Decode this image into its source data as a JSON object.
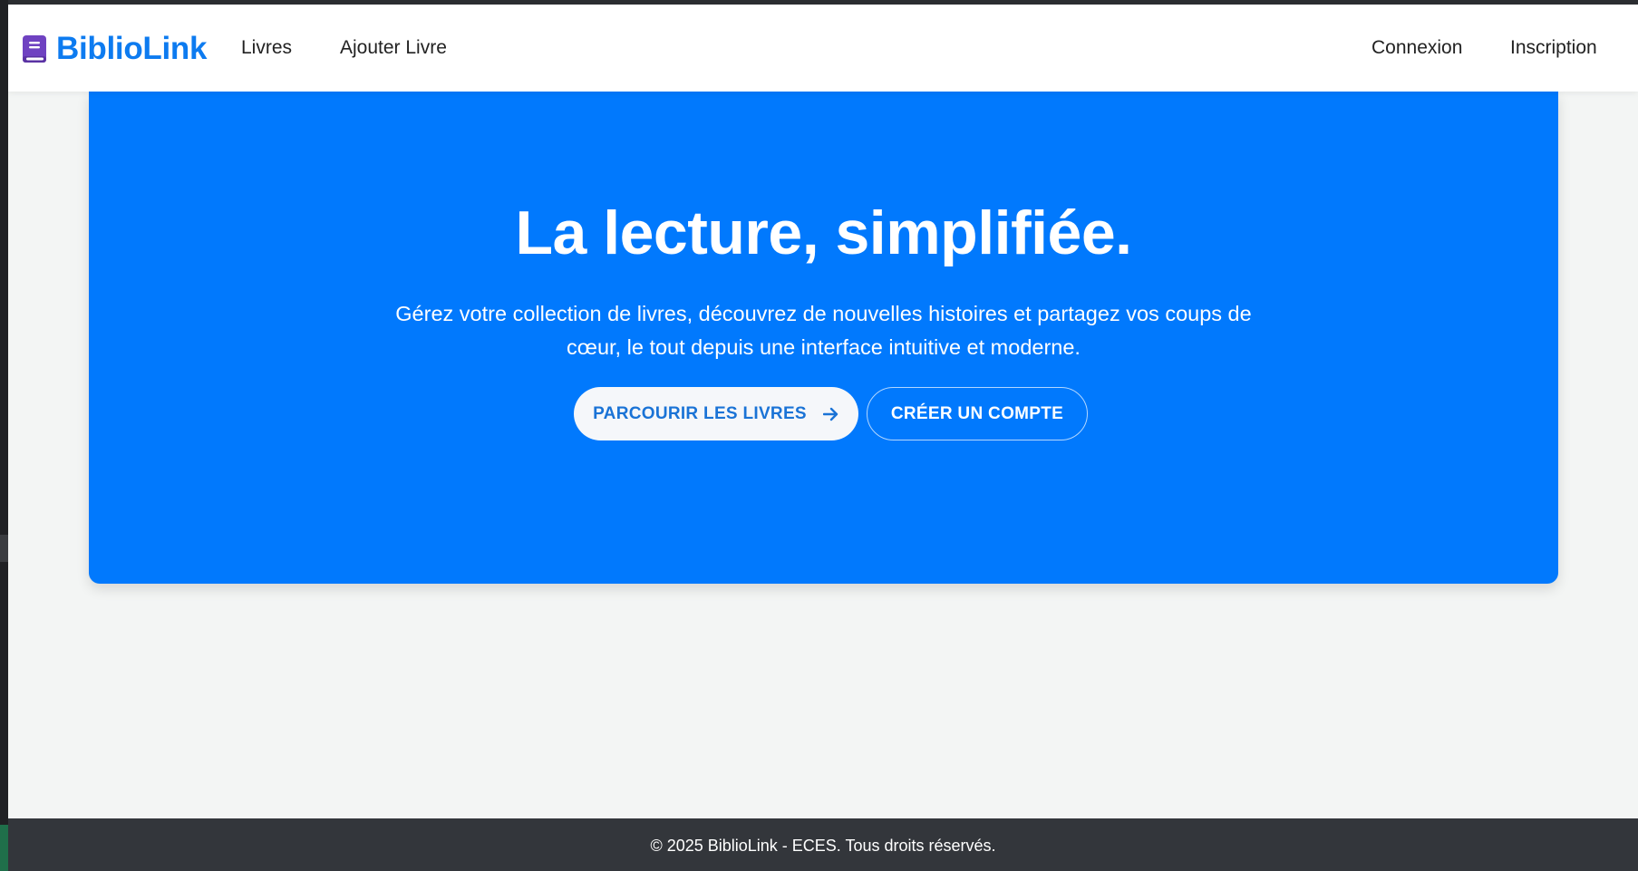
{
  "navbar": {
    "brand": "BiblioLink",
    "brand_icon": "book-icon",
    "brand_icon_color": "#6f42c1",
    "brand_color": "#0d7bf0",
    "links_left": [
      "Livres",
      "Ajouter Livre"
    ],
    "links_right": [
      "Connexion",
      "Inscription"
    ]
  },
  "hero": {
    "background": "#0179fd",
    "title": "La lecture, simplifiée.",
    "subtitle_line1": "Gérez votre collection de livres, découvrez de nouvelles histoires et partagez vos coups de",
    "subtitle_line2": "cœur, le tout depuis une interface intuitive et moderne.",
    "primary_button": "PARCOURIR LES LIVRES",
    "primary_button_icon": "arrow-right-icon",
    "secondary_button": "CRÉER UN COMPTE"
  },
  "footer": {
    "text": "© 2025 BiblioLink - ECES. Tous droits réservés.",
    "background": "#33363b"
  }
}
